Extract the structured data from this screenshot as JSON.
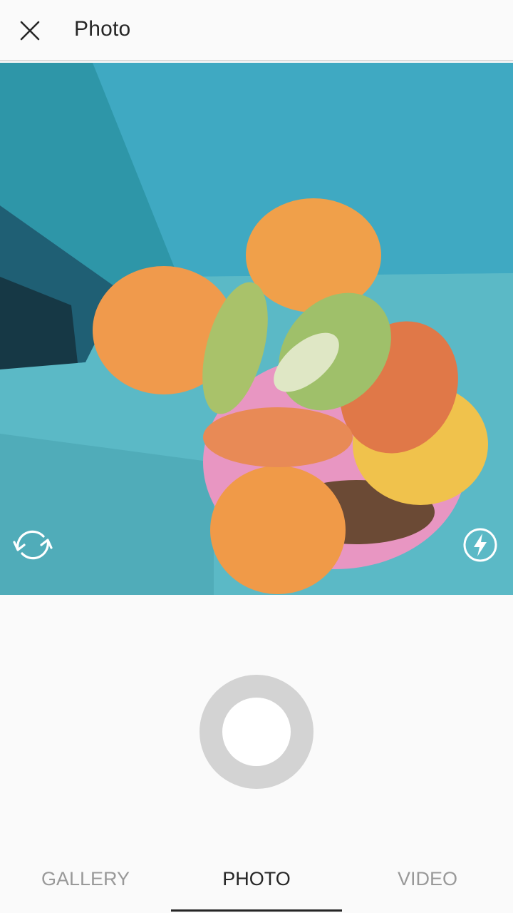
{
  "header": {
    "title": "Photo"
  },
  "icons": {
    "close": "close-icon",
    "flip_camera": "flip-camera-icon",
    "flash": "flash-icon"
  },
  "shutter": {
    "ring_color": "#d3d3d3",
    "inner_color": "#ffffff"
  },
  "tabs": [
    {
      "label": "GALLERY",
      "active": false
    },
    {
      "label": "PHOTO",
      "active": true
    },
    {
      "label": "VIDEO",
      "active": false
    }
  ],
  "colors": {
    "background": "#fafafa",
    "text_primary": "#262626",
    "text_inactive": "#999999"
  }
}
